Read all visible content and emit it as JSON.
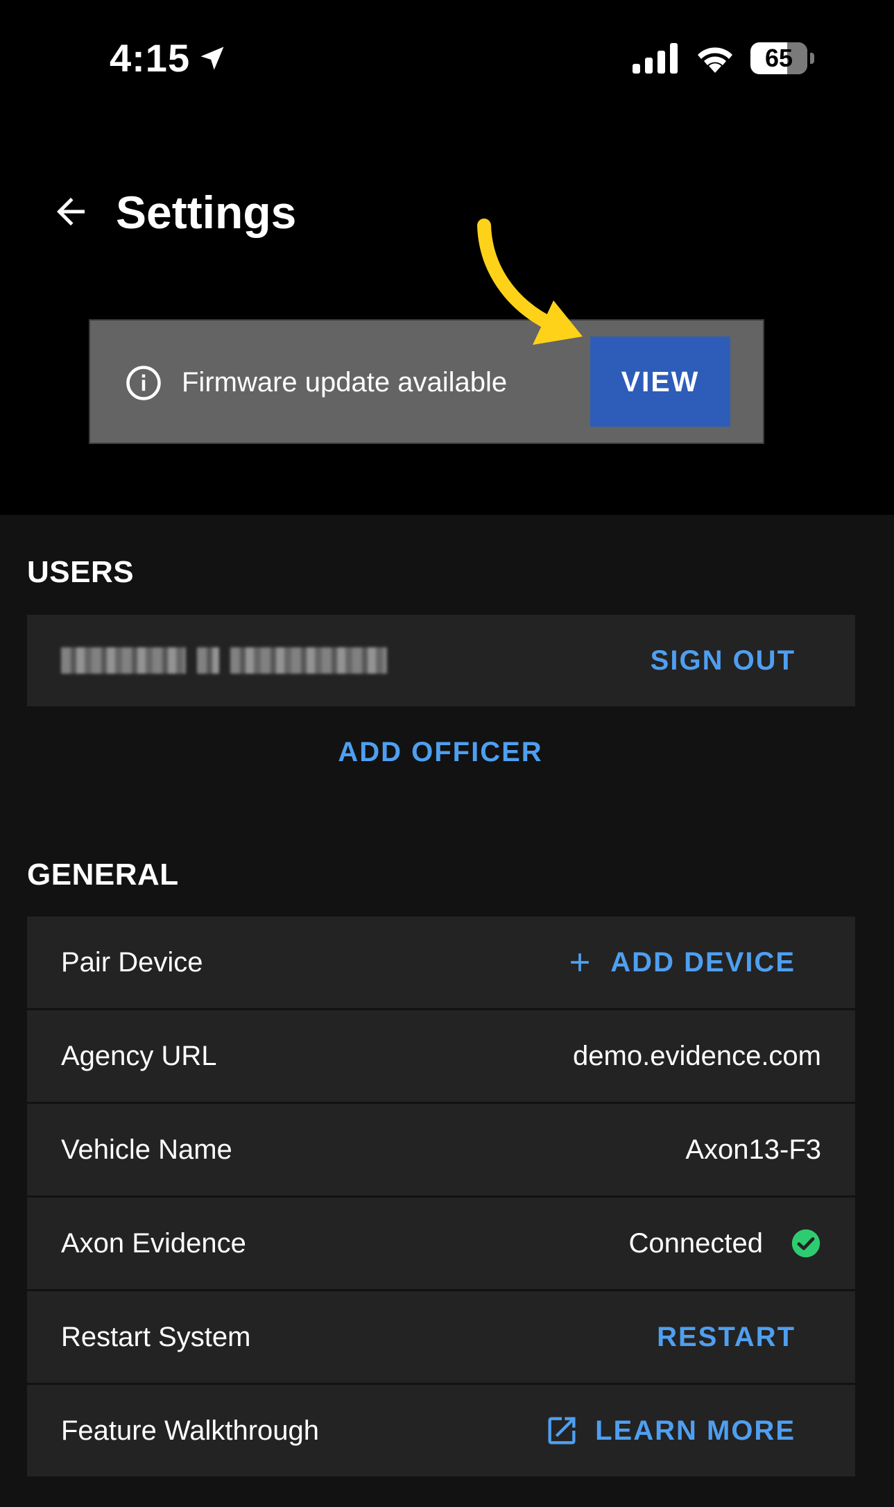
{
  "status_bar": {
    "time": "4:15",
    "battery_level": "65",
    "battery_fraction": 0.65,
    "icons": [
      "location-arrow-icon",
      "cellular-signal-icon",
      "wifi-icon",
      "battery-icon"
    ]
  },
  "header": {
    "title": "Settings",
    "back_icon": "arrow-left-icon"
  },
  "banner": {
    "message": "Firmware update available",
    "action_label": "VIEW",
    "info_icon": "info-icon",
    "annotation": "yellow-arrow-annotation"
  },
  "users": {
    "section_title": "USERS",
    "current_user_action": "SIGN OUT",
    "add_officer_label": "ADD OFFICER"
  },
  "general": {
    "section_title": "GENERAL",
    "rows": [
      {
        "label": "Pair Device",
        "action": "ADD DEVICE",
        "icon": "plus-icon"
      },
      {
        "label": "Agency URL",
        "value": "demo.evidence.com"
      },
      {
        "label": "Vehicle Name",
        "value": "Axon13-F3"
      },
      {
        "label": "Axon Evidence",
        "value": "Connected",
        "icon": "check-circle-icon"
      },
      {
        "label": "Restart System",
        "action": "RESTART"
      },
      {
        "label": "Feature Walkthrough",
        "action": "LEARN MORE",
        "icon": "external-link-icon"
      }
    ]
  },
  "colors": {
    "background": "#121212",
    "header_background": "#000000",
    "row_background": "#232323",
    "banner_background": "#646464",
    "accent": "#4f9ff0",
    "view_button": "#2d5db8",
    "success": "#2ecc71",
    "annotation_arrow": "#ffd21a"
  }
}
